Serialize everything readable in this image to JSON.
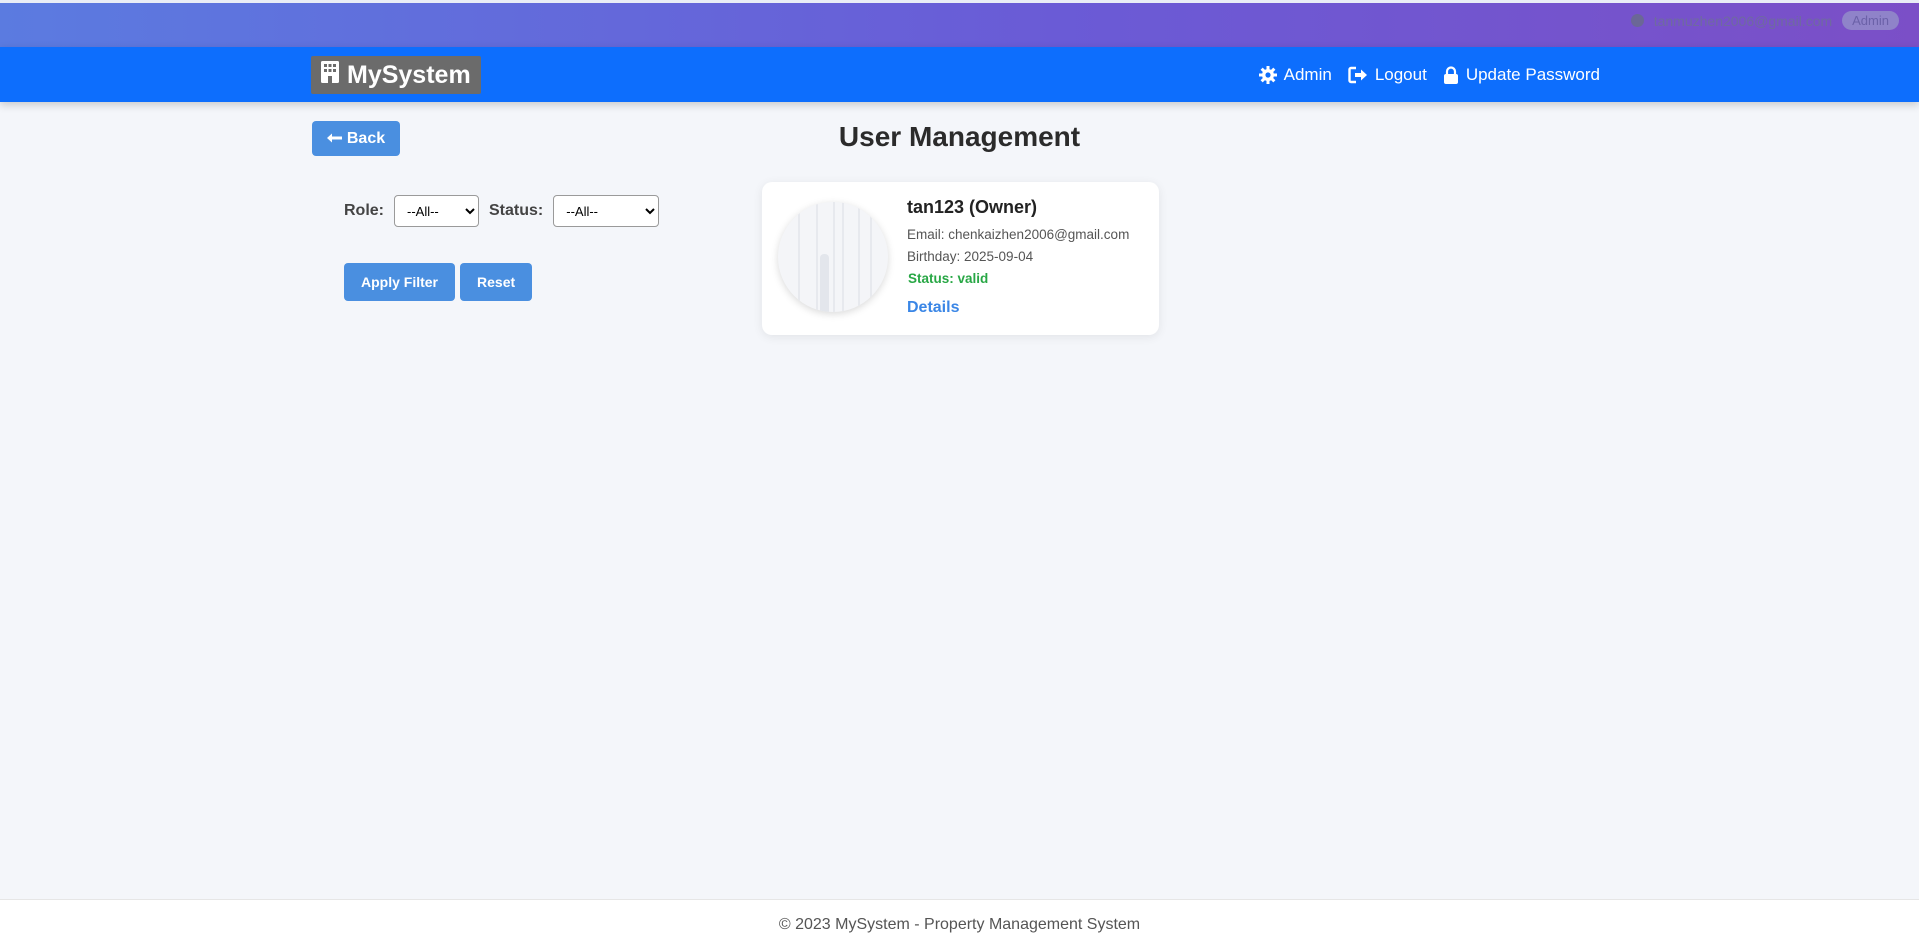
{
  "topbar": {
    "user_email": "tanmuzhen2006@gmail.com",
    "role_badge": "Admin"
  },
  "navbar": {
    "brand": "MySystem",
    "links": {
      "admin": "Admin",
      "logout": "Logout",
      "update_password": "Update Password"
    }
  },
  "page": {
    "back_label": "Back",
    "title": "User Management"
  },
  "filters": {
    "role_label": "Role:",
    "role_value": "--All--",
    "status_label": "Status:",
    "status_value": "--All--",
    "apply_label": "Apply Filter",
    "reset_label": "Reset"
  },
  "users": [
    {
      "name": "tan123 (Owner)",
      "email": "Email: chenkaizhen2006@gmail.com",
      "birthday": "Birthday: 2025-09-04",
      "status": "Status: valid",
      "details_label": "Details"
    }
  ],
  "footer": {
    "text": "© 2023 MySystem - Property Management System"
  },
  "colors": {
    "nav_blue": "#0d6efd",
    "button_blue": "#4a8fe0",
    "status_green": "#28a745"
  }
}
